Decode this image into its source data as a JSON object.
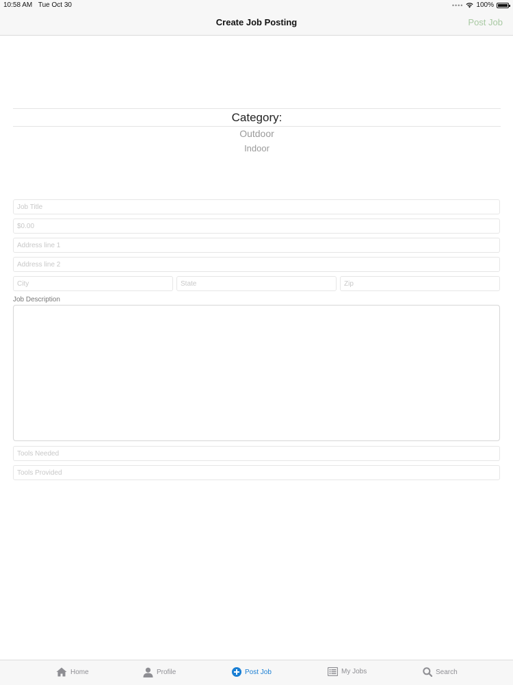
{
  "status_bar": {
    "time": "10:58 AM",
    "date": "Tue Oct 30",
    "battery": "100%"
  },
  "nav": {
    "title": "Create Job Posting",
    "action": "Post Job"
  },
  "category_picker": {
    "selected": "Category:",
    "options": [
      "Outdoor",
      "Indoor"
    ]
  },
  "form": {
    "job_title_placeholder": "Job Title",
    "pay_placeholder": "$0.00",
    "address1_placeholder": "Address line 1",
    "address2_placeholder": "Address line 2",
    "city_placeholder": "City",
    "state_placeholder": "State",
    "zip_placeholder": "Zip",
    "description_label": "Job Description",
    "tools_needed_placeholder": "Tools Needed",
    "tools_provided_placeholder": "Tools Provided"
  },
  "tabs": [
    {
      "label": "Home",
      "icon": "home-icon"
    },
    {
      "label": "Profile",
      "icon": "person-icon"
    },
    {
      "label": "Post Job",
      "icon": "plus-circle-icon"
    },
    {
      "label": "My Jobs",
      "icon": "list-icon"
    },
    {
      "label": "Search",
      "icon": "search-icon"
    }
  ],
  "colors": {
    "active_tab": "#1a7fd4",
    "inactive_tab": "#8e8e93",
    "post_job_action": "#a8c9a2"
  }
}
